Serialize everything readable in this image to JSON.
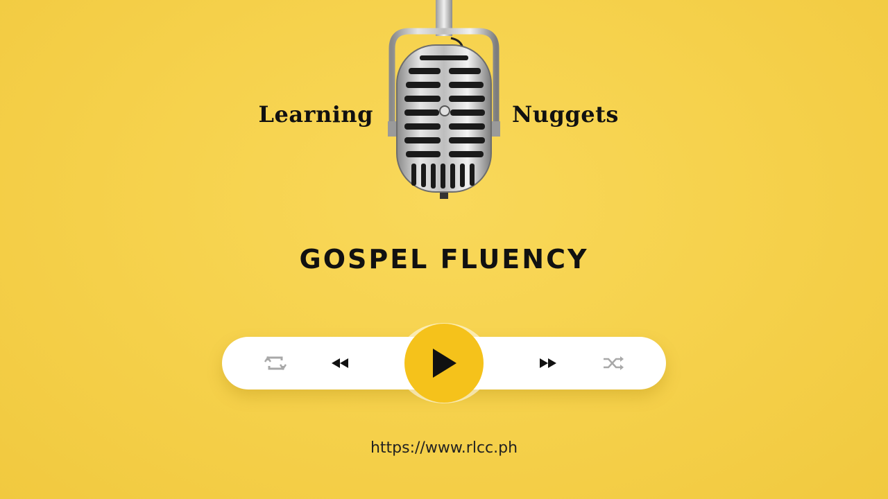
{
  "header": {
    "left_word": "Learning",
    "right_word": "Nuggets"
  },
  "headline": "GOSPEL FLUENCY",
  "player": {
    "controls": [
      {
        "name": "repeat-icon"
      },
      {
        "name": "rewind-icon"
      },
      {
        "name": "play-icon"
      },
      {
        "name": "fast-forward-icon"
      },
      {
        "name": "shuffle-icon"
      }
    ],
    "colors": {
      "play_button": "#f5c21b",
      "bar": "#ffffff",
      "muted_icon": "#a8a8a8",
      "active_icon": "#111111"
    }
  },
  "footer": {
    "url": "https://www.rlcc.ph"
  },
  "colors": {
    "background": "#f6d24d",
    "text": "#111111"
  }
}
